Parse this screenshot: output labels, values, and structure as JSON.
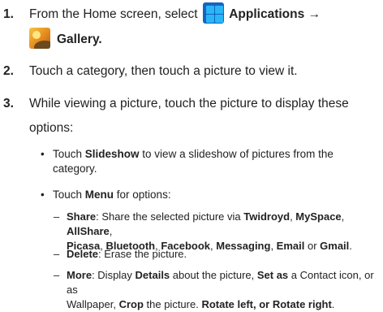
{
  "steps": [
    {
      "number": "1.",
      "apps_icon": "applications-grid-icon",
      "gallery_icon": "gallery-icon",
      "line1_text": "From the Home screen, select",
      "applications": "Applications",
      "arrow": "→",
      "gallery": "Gallery",
      "period": "."
    },
    {
      "number": "2.",
      "text": "Touch a category, then touch a picture to view it."
    },
    {
      "number": "3.",
      "line1": "While viewing a picture, touch the picture to display these",
      "line2": "options:"
    }
  ],
  "bullets": [
    {
      "bullet": "•",
      "pre": "Touch ",
      "bold": "Slideshow",
      "post": "  to view a slideshow of pictures from the",
      "line2": "category."
    },
    {
      "bullet": "•",
      "pre": "Touch ",
      "bold": "Menu",
      "post": "  for options:"
    }
  ],
  "subitems": [
    {
      "dash": "–",
      "bold": "Share",
      "t1": ": Share the selected picture via ",
      "twidroyd": "Twidroyd",
      "c1": ", ",
      "myspace": "MySpace",
      "c2": ", ",
      "allshare": "AllShare",
      "c3": ",",
      "picasa": "Picasa",
      "c4": ", ",
      "bluetooth": "Bluetooth",
      "c5": ", ",
      "facebook": "Facebook",
      "c6": ", ",
      "messaging": "Messaging",
      "c7": ", ",
      "email": "Email",
      "or": " or ",
      "gmail": "Gmail",
      "end": "."
    },
    {
      "dash": "–",
      "bold": "Delete",
      "text": ": Erase the picture."
    },
    {
      "dash": "–",
      "bold": "More",
      "t1": ": Display ",
      "details": "Details",
      "t2": " about the picture, ",
      "setas": "Set as",
      "t3": " a Contact icon, or as",
      "t4": "Wallpaper, ",
      "crop": "Crop",
      "t5": " the picture. ",
      "rotate": "Rotate left, or Rotate right",
      "end": "."
    }
  ]
}
